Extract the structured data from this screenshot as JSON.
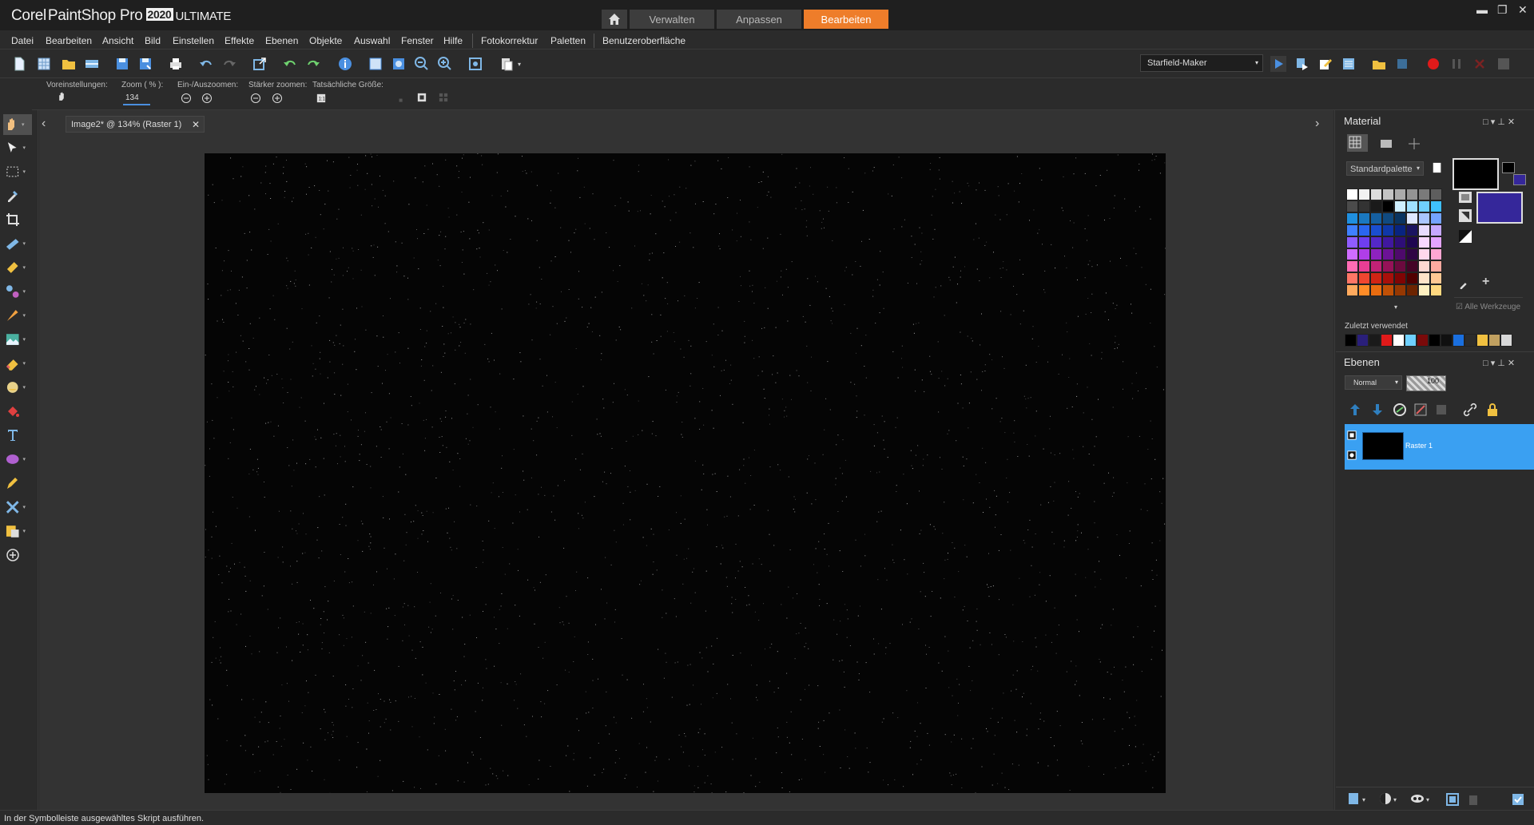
{
  "app": {
    "brand": "Corel",
    "product": "PaintShop Pro",
    "year": "2020",
    "edition": "ULTIMATE"
  },
  "workspace_tabs": [
    {
      "name": "home",
      "icon": "home-icon"
    },
    {
      "label": "Verwalten",
      "active": false
    },
    {
      "label": "Anpassen",
      "active": false
    },
    {
      "label": "Bearbeiten",
      "active": true
    }
  ],
  "window_controls": [
    "minimize-icon",
    "restore-icon",
    "close-icon"
  ],
  "menu": [
    "Datei",
    "Bearbeiten",
    "Ansicht",
    "Bild",
    "Einstellen",
    "Effekte",
    "Ebenen",
    "Objekte",
    "Auswahl",
    "Fenster",
    "Hilfe",
    "Fotokorrektur",
    "Paletten",
    "Benutzeroberfläche"
  ],
  "toolbar": {
    "script_selector": "Starfield-Maker"
  },
  "tool_options": {
    "presets_label": "Voreinstellungen:",
    "zoom_label": "Zoom ( % ):",
    "zoom_value": "134",
    "zoom_in_out_label": "Ein-/Auszoomen:",
    "zoom_more_label": "Stärker zoomen:",
    "actual_size_label": "Tatsächliche Größe:"
  },
  "document": {
    "tab_label": "Image2* @ 134% (Raster 1)"
  },
  "material_panel": {
    "title": "Material",
    "palette_select": "Standardpalette",
    "all_tools_label": "Alle Werkzeuge",
    "recent_label": "Zuletzt verwendet",
    "foreground_color": "#000000",
    "background_color": "#35279a"
  },
  "layers_panel": {
    "title": "Ebenen",
    "blend_mode": "Normal",
    "opacity": "100",
    "layers": [
      {
        "name": "Raster 1",
        "selected": true
      }
    ]
  },
  "status": {
    "text": "In der Symbolleiste ausgewähltes Skript ausführen."
  },
  "colors": {
    "accent": "#ee7d2a",
    "selection": "#3aa0f2",
    "panel": "#2b2b2b"
  }
}
